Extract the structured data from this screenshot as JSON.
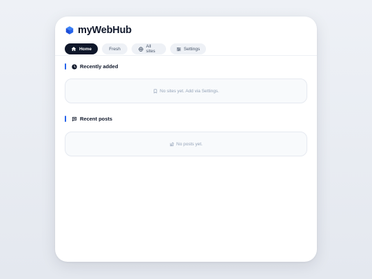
{
  "brand": {
    "name": "myWebHub",
    "logo_icon": "cube-icon",
    "accent_color": "#2563eb"
  },
  "tabs": [
    {
      "label": "Home",
      "icon": "home-icon",
      "active": true
    },
    {
      "label": "Fresh",
      "icon": "",
      "active": false
    },
    {
      "label": "All sites",
      "icon": "globe-icon",
      "active": false
    },
    {
      "label": "Settings",
      "icon": "sliders-icon",
      "active": false
    }
  ],
  "sections": {
    "recently_added": {
      "title": "Recently added",
      "icon": "clock-icon",
      "empty_text": "No sites yet. Add via Settings.",
      "empty_icon": "bookmark-icon"
    },
    "recent_posts": {
      "title": "Recent posts",
      "icon": "chat-bubble-icon",
      "empty_text": "No posts yet.",
      "empty_icon": "edit-icon"
    }
  }
}
